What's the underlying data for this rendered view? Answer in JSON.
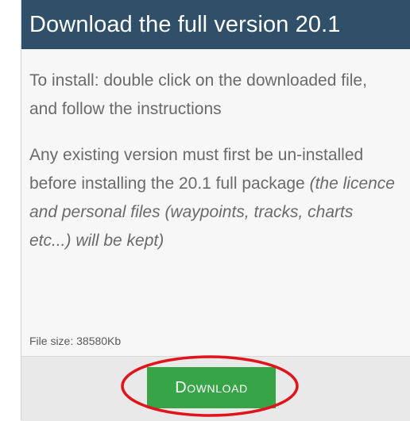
{
  "header": {
    "title": "Download the full version 20.1"
  },
  "body": {
    "install_instructions": "To install: double click on the downloaded file, and follow the instructions",
    "uninstall_notice": "Any existing version must first be un-installed before installing the 20.1 full package",
    "kept_note": "(the licence and personal files (waypoints, tracks, charts etc...) will be kept)",
    "file_size": "File size: 38580Kb"
  },
  "footer": {
    "download_label": "Download"
  },
  "colors": {
    "header_bg": "#2f5068",
    "button_bg": "#37a447",
    "highlight_ring": "#e0141c"
  }
}
